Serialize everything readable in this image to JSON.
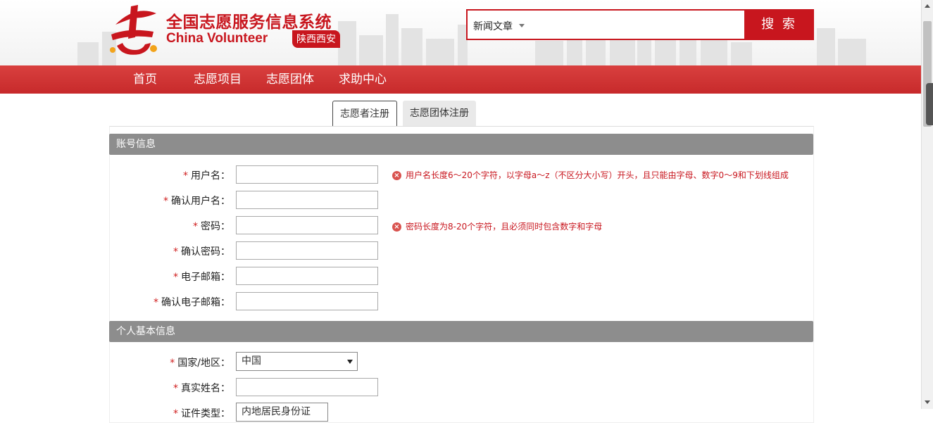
{
  "brand": {
    "title": "全国志愿服务信息系统",
    "subtitle": "China Volunteer",
    "region": "陕西西安",
    "logo_char": "志"
  },
  "search": {
    "type_label": "新闻文章",
    "placeholder": "",
    "button_label": "搜 索"
  },
  "nav": {
    "items": [
      "首页",
      "志愿项目",
      "志愿团体",
      "求助中心"
    ]
  },
  "tabs": [
    {
      "label": "志愿者注册",
      "active": true
    },
    {
      "label": "志愿团体注册",
      "active": false
    }
  ],
  "account_section": {
    "title": "账号信息",
    "fields": [
      {
        "label": "用户名：",
        "error": "用户名长度6～20个字符，以字母a～z（不区分大小写）开头，且只能由字母、数字0～9和下划线组成"
      },
      {
        "label": "确认用户名：",
        "error": ""
      },
      {
        "label": "密码：",
        "error": "密码长度为8-20个字符，且必须同时包含数字和字母"
      },
      {
        "label": "确认密码：",
        "error": ""
      },
      {
        "label": "电子邮箱：",
        "error": ""
      },
      {
        "label": "确认电子邮箱：",
        "error": ""
      }
    ]
  },
  "personal_section": {
    "title": "个人基本信息",
    "fields": [
      {
        "label": "国家/地区：",
        "value": "中国"
      },
      {
        "label": "真实姓名：",
        "value": ""
      },
      {
        "label": "证件类型：",
        "value": "内地居民身份证"
      }
    ]
  },
  "required_mark": "*",
  "error_icon": "x-circle-icon",
  "colors": {
    "brand_red": "#c8161e",
    "nav_red": "#d0302f",
    "section_gray": "#8d8d8d",
    "error_red": "#c8161e"
  }
}
